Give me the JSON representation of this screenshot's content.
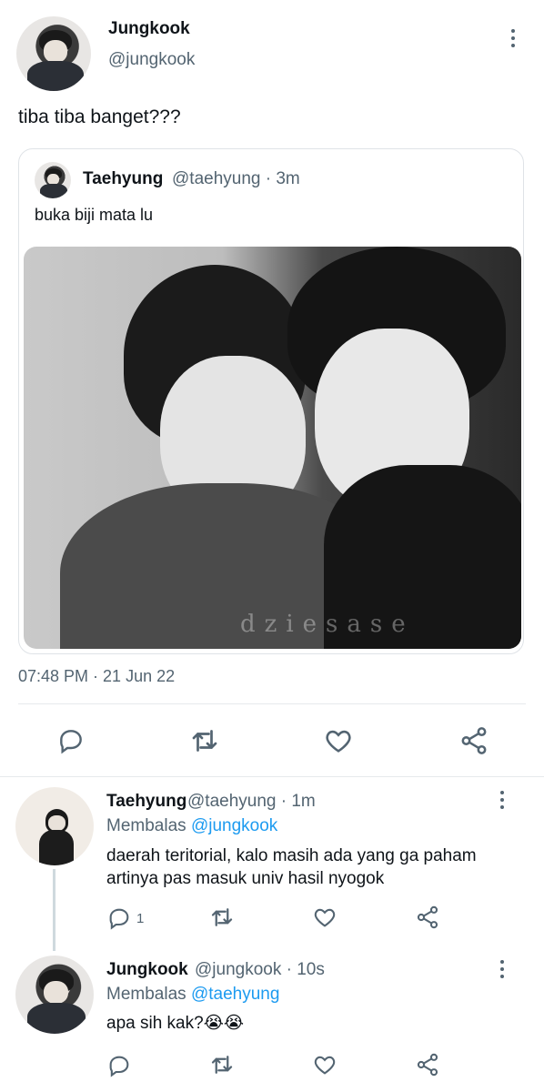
{
  "main_tweet": {
    "name": "Jungkook",
    "handle": "@jungkook",
    "text": "tiba tiba banget???",
    "timestamp": "07:48 PM · 21 Jun 22"
  },
  "quoted": {
    "name": "Taehyung",
    "handle_time": "@taehyung · 3m",
    "text": "buka biji mata lu",
    "watermark": "dziesase"
  },
  "actions": {
    "icons": [
      "reply-icon",
      "retweet-icon",
      "like-icon",
      "share-icon"
    ]
  },
  "replies": [
    {
      "name": "Taehyung",
      "handle_time": "@taehyung · 1m",
      "replying_prefix": "Membalas",
      "replying_to": "@jungkook",
      "text_line1": "daerah teritorial, kalo masih ada yang ga paham",
      "text_line2": "artinya pas masuk univ hasil nyogok",
      "reply_count": "1"
    },
    {
      "name": "Jungkook",
      "handle_time": "@jungkook · 10s",
      "replying_prefix": "Membalas",
      "replying_to": "@taehyung",
      "text": "apa sih kak?",
      "emoji": "😭😭"
    }
  ],
  "colors": {
    "accent": "#1d9bf0",
    "muted": "#536471",
    "text": "#0f1419",
    "divider": "#e6e9ec"
  }
}
